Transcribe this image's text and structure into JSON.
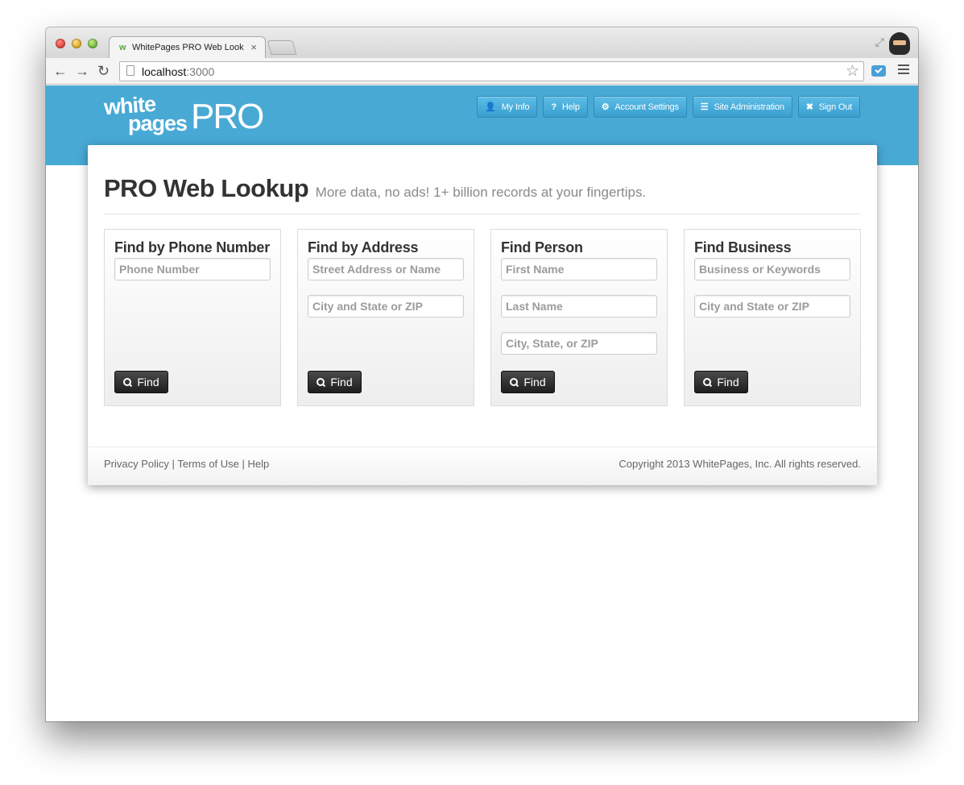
{
  "browser": {
    "tab_title": "WhitePages PRO Web Look",
    "tab_close": "×",
    "url_host": "localhost",
    "url_port": ":3000",
    "favicon": "w"
  },
  "logo": {
    "white": "white",
    "pages": "pages",
    "pro": "PRO"
  },
  "nav": [
    {
      "label": "My Info",
      "icon": "user-icon",
      "glyph": "👤"
    },
    {
      "label": "Help",
      "icon": "question-icon",
      "glyph": "?"
    },
    {
      "label": "Account Settings",
      "icon": "gear-icon",
      "glyph": "⚙"
    },
    {
      "label": "Site Administration",
      "icon": "list-icon",
      "glyph": "☰"
    },
    {
      "label": "Sign Out",
      "icon": "close-icon",
      "glyph": "✖"
    }
  ],
  "heading": {
    "title": "PRO Web Lookup",
    "subtitle": "More data, no ads! 1+ billion records at your fingertips."
  },
  "panels": {
    "phone": {
      "title": "Find by Phone Number",
      "fields": [
        "Phone Number"
      ],
      "button": "Find"
    },
    "address": {
      "title": "Find by Address",
      "fields": [
        "Street Address or Name",
        "City and State or ZIP"
      ],
      "button": "Find"
    },
    "person": {
      "title": "Find Person",
      "fields": [
        "First Name",
        "Last Name",
        "City, State, or ZIP"
      ],
      "button": "Find"
    },
    "business": {
      "title": "Find Business",
      "fields": [
        "Business or Keywords",
        "City and State or ZIP"
      ],
      "button": "Find"
    }
  },
  "footer": {
    "privacy": "Privacy Policy",
    "terms": "Terms of Use",
    "help": "Help",
    "separator": "|",
    "copyright": "Copyright 2013 WhitePages, Inc. All rights reserved."
  },
  "colors": {
    "header_blue": "#48a9d5",
    "button_dark": "#2a2a2a"
  }
}
